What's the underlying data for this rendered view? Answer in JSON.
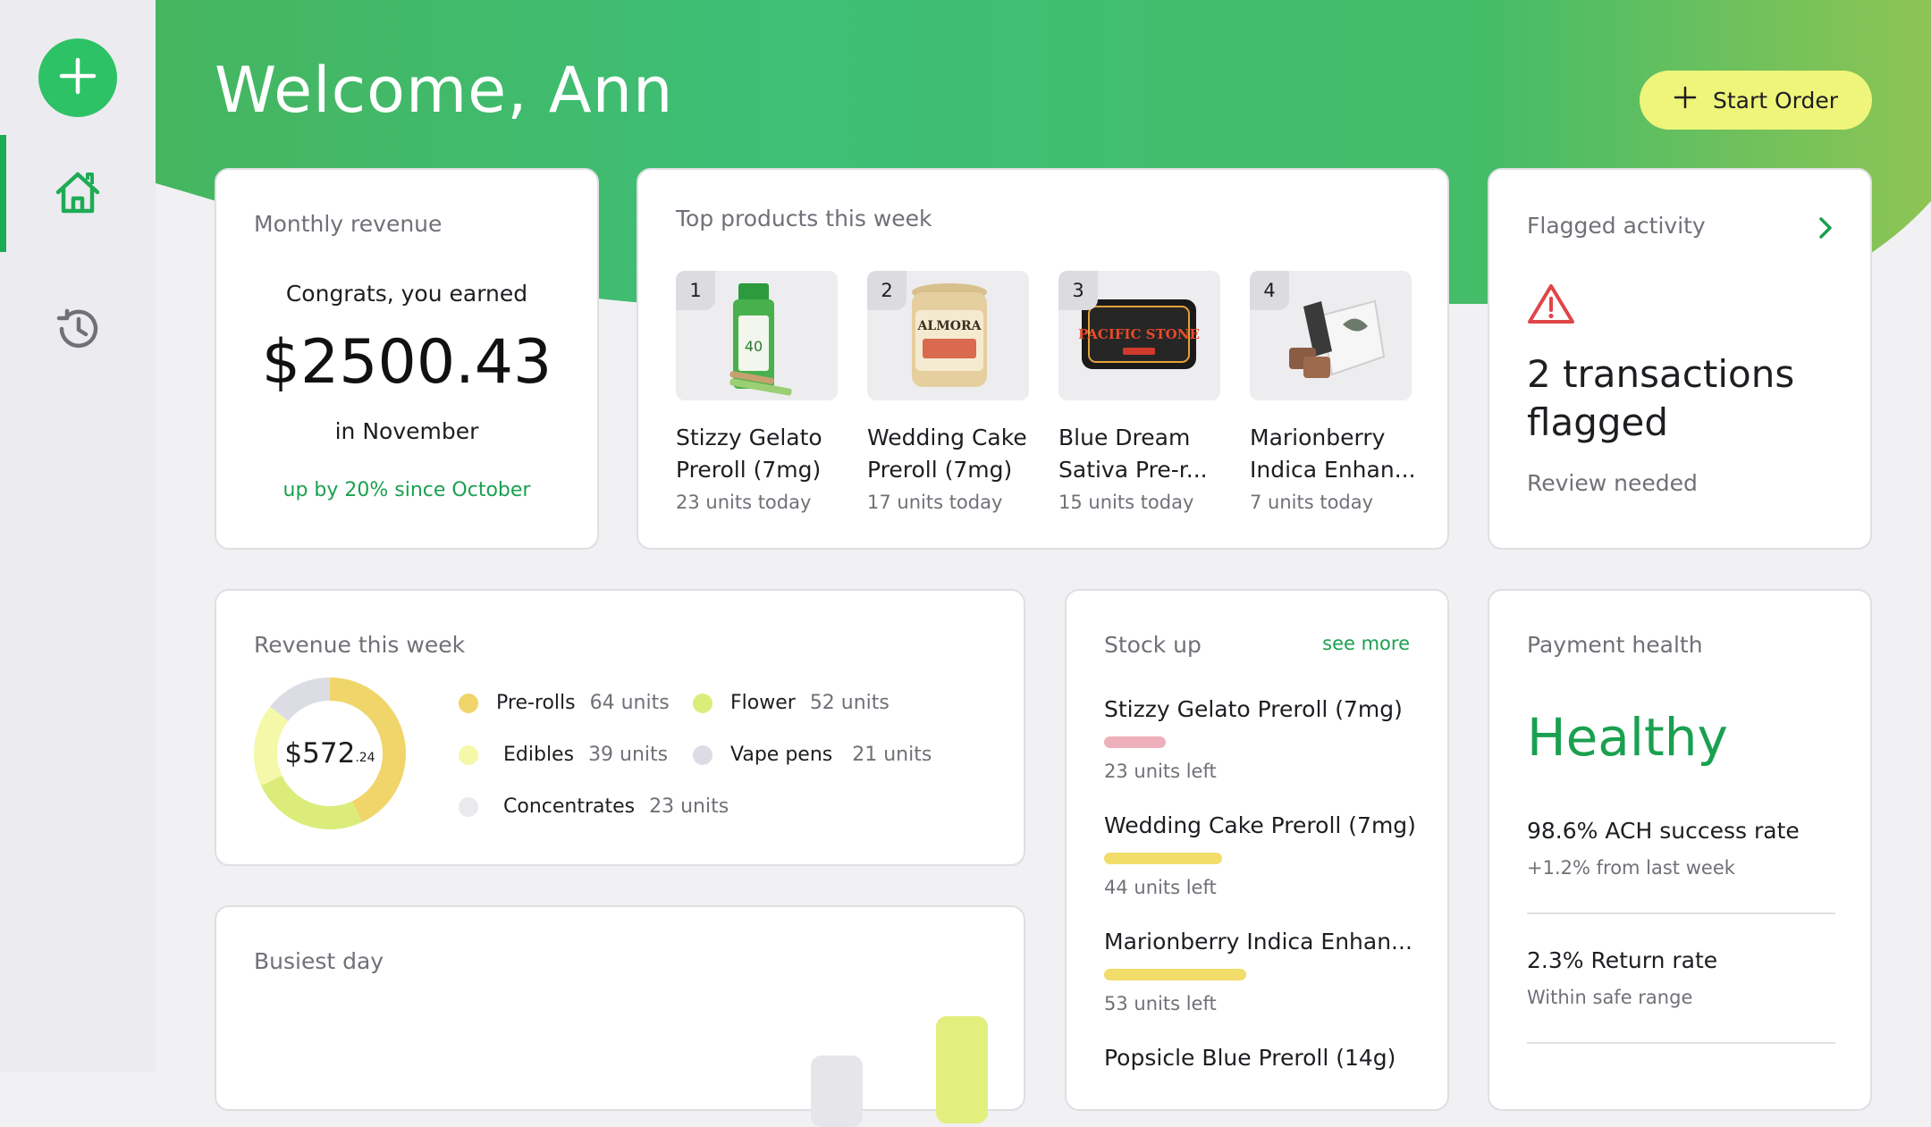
{
  "header": {
    "welcome": "Welcome, Ann",
    "start_order_label": "Start Order"
  },
  "sidebar": {
    "items": [
      {
        "icon": "plus-icon",
        "active": false
      },
      {
        "icon": "home-icon",
        "active": true
      },
      {
        "icon": "history-icon",
        "active": false
      }
    ]
  },
  "monthly_revenue": {
    "title": "Monthly revenue",
    "congrats": "Congrats, you earned",
    "amount": "$2500.43",
    "period": "in November",
    "change": "up by 20% since October"
  },
  "top_products": {
    "title": "Top products this week",
    "items": [
      {
        "rank": "1",
        "name_line1": "Stizzy Gelato",
        "name_line2": "Preroll (7mg)",
        "units": "23 units today"
      },
      {
        "rank": "2",
        "name_line1": "Wedding Cake",
        "name_line2": "Preroll (7mg)",
        "units": "17 units today"
      },
      {
        "rank": "3",
        "name_line1": "Blue Dream",
        "name_line2": "Sativa Pre-r...",
        "units": "15 units today"
      },
      {
        "rank": "4",
        "name_line1": "Marionberry",
        "name_line2": "Indica Enhan...",
        "units": "7 units today"
      }
    ]
  },
  "flagged": {
    "title": "Flagged activity",
    "line1": "2 transactions",
    "line2": "flagged",
    "sub": "Review needed"
  },
  "revenue_week": {
    "title": "Revenue this week",
    "total_main": "$572",
    "total_cents": ".24",
    "categories": [
      {
        "name": "Pre-rolls",
        "units": "64 units",
        "color": "#f0d56a"
      },
      {
        "name": "Flower",
        "units": "52 units",
        "color": "#dcec7a"
      },
      {
        "name": "Edibles",
        "units": "39 units",
        "color": "#f4f8a8"
      },
      {
        "name": "Vape pens",
        "units": "21 units",
        "color": "#dcdce4"
      },
      {
        "name": "Concentrates",
        "units": "23 units",
        "color": "#eaeaee"
      }
    ]
  },
  "busiest_day": {
    "title": "Busiest day"
  },
  "stock_up": {
    "title": "Stock up",
    "see_more": "see more",
    "items": [
      {
        "name": "Stizzy Gelato Preroll (7mg)",
        "left": "23 units left",
        "level": 0.23,
        "color": "#eeb0bb"
      },
      {
        "name": "Wedding Cake Preroll (7mg)",
        "left": "44 units left",
        "level": 0.44,
        "color": "#f2dc6a"
      },
      {
        "name": "Marionberry Indica Enhan...",
        "left": "53 units left",
        "level": 0.53,
        "color": "#f2dc6a"
      },
      {
        "name": "Popsicle Blue Preroll (14g)",
        "left": "",
        "level": 0,
        "color": "#f2dc6a"
      }
    ]
  },
  "payment_health": {
    "title": "Payment health",
    "status": "Healthy",
    "metrics": [
      {
        "main": "98.6% ACH success rate",
        "sub": "+1.2% from last week"
      },
      {
        "main": "2.3% Return rate",
        "sub": "Within safe range"
      }
    ]
  },
  "colors": {
    "brand_green": "#2ec266",
    "accent_yellow": "#eef57a",
    "alert_red": "#e0454a"
  }
}
